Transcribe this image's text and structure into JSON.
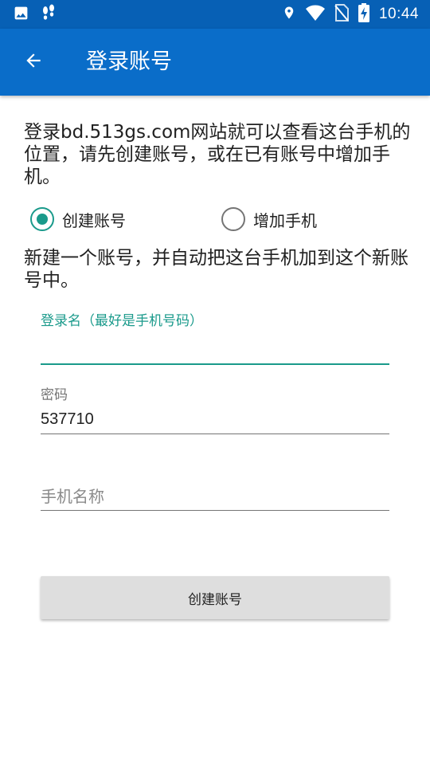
{
  "status_bar": {
    "time": "10:44",
    "left_icons": [
      "image-icon",
      "footprints-icon"
    ],
    "right_icons": [
      "location-icon",
      "wifi-icon",
      "no-sim-icon",
      "battery-charging-icon"
    ]
  },
  "app_bar": {
    "title": "登录账号",
    "back_icon": "arrow-left-icon",
    "color": "#0a6dc9"
  },
  "intro_text": "登录bd.513gs.com网站就可以查看这台手机的位置，请先创建账号，或在已有账号中增加手机。",
  "radio_options": [
    {
      "label": "创建账号",
      "checked": true
    },
    {
      "label": "增加手机",
      "checked": false
    }
  ],
  "description": "新建一个账号，并自动把这台手机加到这个新账号中。",
  "form": {
    "login_name": {
      "label": "登录名（最好是手机号码）",
      "value": ""
    },
    "password": {
      "label": "密码",
      "value": "537710"
    },
    "phone_name": {
      "placeholder": "手机名称",
      "value": ""
    }
  },
  "submit_label": "创建账号",
  "accent_color": "#1a9a8b"
}
